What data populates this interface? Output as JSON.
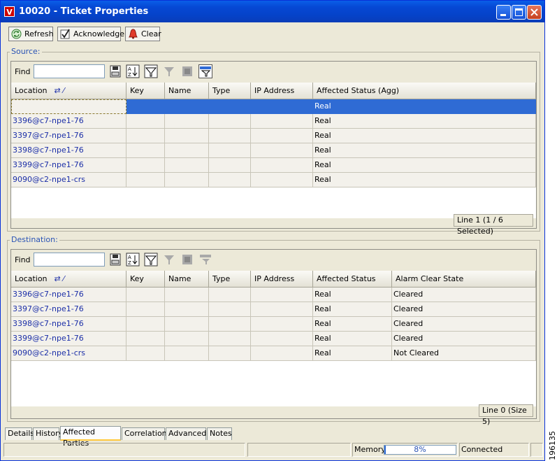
{
  "window": {
    "icon_letter": "V",
    "title": "10020 - Ticket Properties"
  },
  "toolbar": {
    "refresh_label": "Refresh",
    "acknowledge_label": "Acknowledge",
    "clear_label": "Clear"
  },
  "source": {
    "group_label": "Source:",
    "find_label": "Find :",
    "find_value": "",
    "columns": [
      "Location",
      "Key",
      "Name",
      "Type",
      "IP Address",
      "Affected Status (Agg)"
    ],
    "rows": [
      {
        "location": "",
        "key": "",
        "name": "",
        "type": "",
        "ip": "",
        "status": "Real",
        "selected": true
      },
      {
        "location": "3396@c7-npe1-76",
        "key": "",
        "name": "",
        "type": "",
        "ip": "",
        "status": "Real"
      },
      {
        "location": "3397@c7-npe1-76",
        "key": "",
        "name": "",
        "type": "",
        "ip": "",
        "status": "Real"
      },
      {
        "location": "3398@c7-npe1-76",
        "key": "",
        "name": "",
        "type": "",
        "ip": "",
        "status": "Real"
      },
      {
        "location": "3399@c7-npe1-76",
        "key": "",
        "name": "",
        "type": "",
        "ip": "",
        "status": "Real"
      },
      {
        "location": "9090@c2-npe1-crs",
        "key": "",
        "name": "",
        "type": "",
        "ip": "",
        "status": "Real"
      }
    ],
    "status_line": "Line 1 (1 / 6 Selected)"
  },
  "destination": {
    "group_label": "Destination:",
    "find_label": "Find :",
    "find_value": "",
    "columns": [
      "Location",
      "Key",
      "Name",
      "Type",
      "IP Address",
      "Affected Status",
      "Alarm Clear State"
    ],
    "rows": [
      {
        "location": "3396@c7-npe1-76",
        "key": "",
        "name": "",
        "type": "",
        "ip": "",
        "status": "Real",
        "clear_state": "Cleared"
      },
      {
        "location": "3397@c7-npe1-76",
        "key": "",
        "name": "",
        "type": "",
        "ip": "",
        "status": "Real",
        "clear_state": "Cleared"
      },
      {
        "location": "3398@c7-npe1-76",
        "key": "",
        "name": "",
        "type": "",
        "ip": "",
        "status": "Real",
        "clear_state": "Cleared"
      },
      {
        "location": "3399@c7-npe1-76",
        "key": "",
        "name": "",
        "type": "",
        "ip": "",
        "status": "Real",
        "clear_state": "Cleared"
      },
      {
        "location": "9090@c2-npe1-crs",
        "key": "",
        "name": "",
        "type": "",
        "ip": "",
        "status": "Real",
        "clear_state": "Not Cleared"
      }
    ],
    "status_line": "Line 0 (Size 5)"
  },
  "tabs": [
    "Details",
    "History",
    "Affected Parties",
    "Correlation",
    "Advanced",
    "Notes"
  ],
  "active_tab": "Affected Parties",
  "statusbar": {
    "memory_label": "Memory:",
    "memory_value": "8%",
    "memory_fraction": 0.02,
    "connection": "Connected"
  },
  "figure_code": "196135",
  "colors": {
    "titlebar": "#0648d4",
    "selection": "#2f6bd4",
    "link_text": "#1c2fa8",
    "group_label": "#2a53b5",
    "active_tab_accent": "#ffc83c"
  }
}
